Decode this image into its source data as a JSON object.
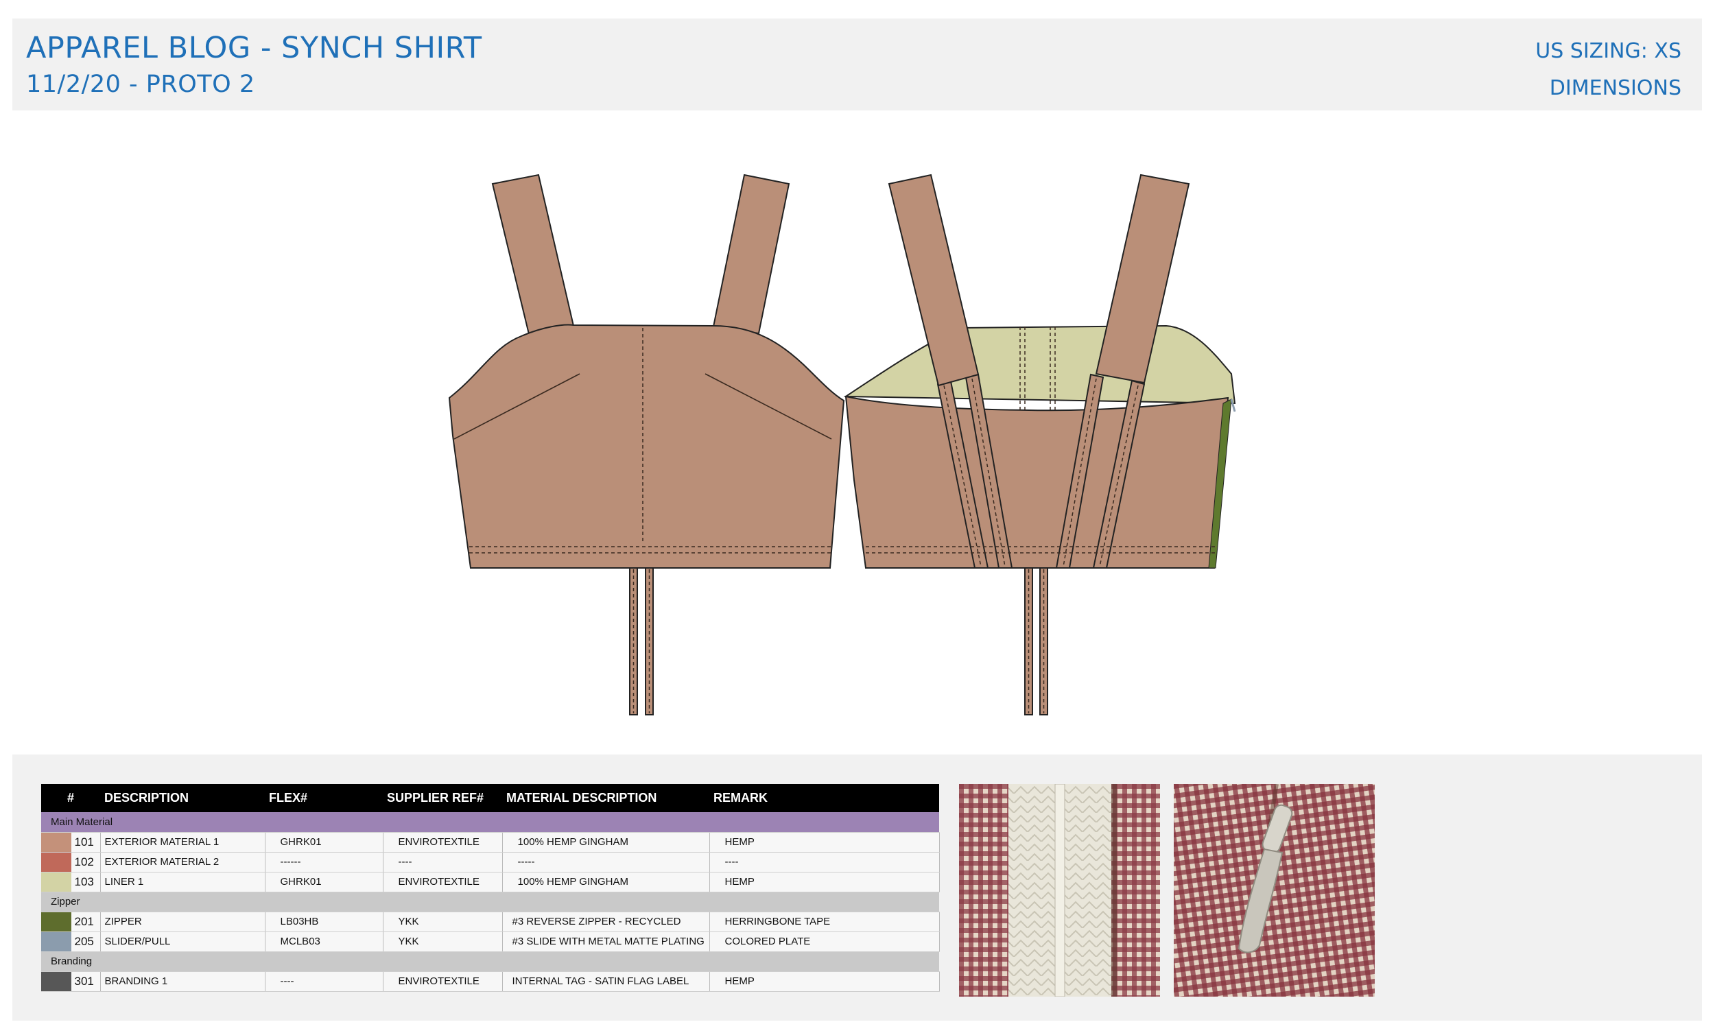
{
  "header": {
    "title": "APPAREL BLOG - SYNCH SHIRT",
    "subtitle": "11/2/20 - PROTO 2",
    "sizing": "US SIZING: XS",
    "dimensions": "DIMENSIONS"
  },
  "colors": {
    "accent": "#1f70b8",
    "garment": "#ba8f78",
    "liner": "#d3d3a5",
    "zipper_tape": "#5e7a2e"
  },
  "bom": {
    "columns": [
      "#",
      "DESCRIPTION",
      "FLEX#",
      "SUPPLIER REF#",
      "MATERIAL DESCRIPTION",
      "REMARK"
    ],
    "sections": [
      {
        "name": "Main Material",
        "rows": [
          {
            "swatch": "#c4917a",
            "num": "101",
            "description": "EXTERIOR MATERIAL 1",
            "flex": "GHRK01",
            "supplier": "ENVIROTEXTILE",
            "material": "100% HEMP GINGHAM",
            "remark": "HEMP"
          },
          {
            "swatch": "#c0695a",
            "num": "102",
            "description": "EXTERIOR MATERIAL 2",
            "flex": "------",
            "supplier": "----",
            "material": "-----",
            "remark": "----"
          },
          {
            "swatch": "#d3d3a5",
            "num": "103",
            "description": "LINER 1",
            "flex": "GHRK01",
            "supplier": "ENVIROTEXTILE",
            "material": "100% HEMP GINGHAM",
            "remark": "HEMP"
          }
        ]
      },
      {
        "name": "Zipper",
        "rows": [
          {
            "swatch": "#5e6d2d",
            "num": "201",
            "description": "ZIPPER",
            "flex": "LB03HB",
            "supplier": "YKK",
            "material": "#3 REVERSE ZIPPER - RECYCLED",
            "remark": "HERRINGBONE TAPE"
          },
          {
            "swatch": "#8b9cad",
            "num": "205",
            "description": "SLIDER/PULL",
            "flex": "MCLB03",
            "supplier": "YKK",
            "material": "#3 SLIDE WITH METAL MATTE PLATING",
            "remark": "COLORED PLATE"
          }
        ]
      },
      {
        "name": "Branding",
        "rows": [
          {
            "swatch": "#575757",
            "num": "301",
            "description": "BRANDING 1",
            "flex": "----",
            "supplier": "ENVIROTEXTILE",
            "material": "INTERNAL TAG - SATIN FLAG LABEL",
            "remark": "HEMP"
          }
        ]
      }
    ]
  },
  "sketches": {
    "front": "front-view",
    "back": "back-view"
  },
  "photos": [
    "zipper-tape-photo",
    "zipper-pull-photo"
  ]
}
